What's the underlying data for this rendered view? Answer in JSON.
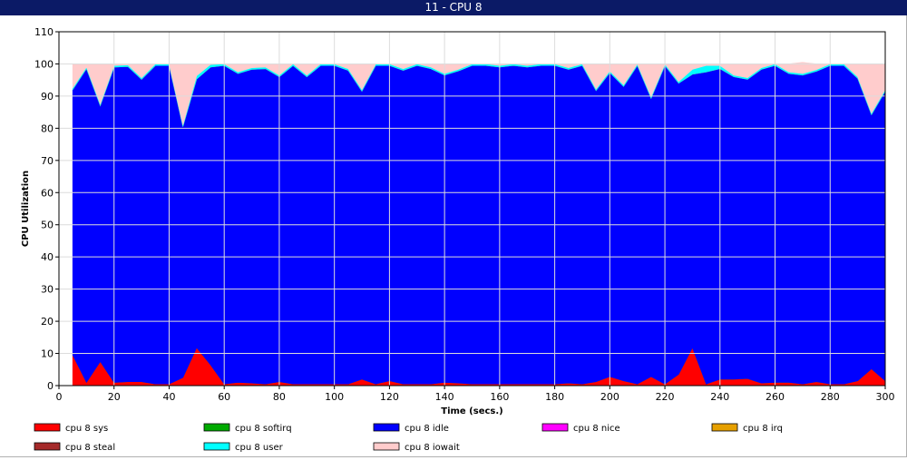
{
  "window": {
    "title": "11 - CPU 8"
  },
  "chart_data": {
    "type": "area",
    "title": "",
    "xlabel": "Time (secs.)",
    "ylabel": "CPU Utilization",
    "xlim": [
      0,
      300
    ],
    "ylim": [
      0,
      110
    ],
    "xticks": [
      0,
      20,
      40,
      60,
      80,
      100,
      120,
      140,
      160,
      180,
      200,
      220,
      240,
      260,
      280,
      300
    ],
    "yticks": [
      0,
      10,
      20,
      30,
      40,
      50,
      60,
      70,
      80,
      90,
      100,
      110
    ],
    "grid": true,
    "legend_position": "bottom",
    "x": [
      5,
      10,
      15,
      20,
      25,
      30,
      35,
      40,
      45,
      50,
      55,
      60,
      65,
      70,
      75,
      80,
      85,
      90,
      95,
      100,
      105,
      110,
      115,
      120,
      125,
      130,
      135,
      140,
      145,
      150,
      155,
      160,
      165,
      170,
      175,
      180,
      185,
      190,
      195,
      200,
      205,
      210,
      215,
      220,
      225,
      230,
      235,
      240,
      245,
      250,
      255,
      260,
      265,
      270,
      275,
      280,
      285,
      290,
      295,
      300
    ],
    "series": [
      {
        "name": "cpu 8 sys",
        "color": "#ff0000",
        "values": [
          9.5,
          1.0,
          7.5,
          1.0,
          1.2,
          1.2,
          0.5,
          0.5,
          2.5,
          11.8,
          6.5,
          0.5,
          1.0,
          0.8,
          0.5,
          1.2,
          0.5,
          0.5,
          0.5,
          0.5,
          0.5,
          2.0,
          0.5,
          1.5,
          0.5,
          0.5,
          0.5,
          1.0,
          0.8,
          0.5,
          0.5,
          0.5,
          0.5,
          0.5,
          0.5,
          0.5,
          0.8,
          0.5,
          1.2,
          2.8,
          1.5,
          0.5,
          2.8,
          0.5,
          3.5,
          11.8,
          0.5,
          2.0,
          2.0,
          2.2,
          0.8,
          1.0,
          1.0,
          0.5,
          1.2,
          0.5,
          0.5,
          1.5,
          5.2,
          1.5
        ]
      },
      {
        "name": "cpu 8 softirq",
        "color": "#00aa00",
        "values": [
          0,
          0,
          0,
          0,
          0,
          0,
          0,
          0,
          0,
          0,
          0,
          0,
          0,
          0,
          0,
          0,
          0,
          0,
          0,
          0,
          0,
          0,
          0,
          0,
          0,
          0,
          0,
          0,
          0,
          0,
          0,
          0,
          0,
          0,
          0,
          0,
          0,
          0,
          0,
          0,
          0,
          0,
          0,
          0,
          0,
          0,
          0,
          0,
          0,
          0,
          0,
          0,
          0,
          0,
          0,
          0,
          0,
          0,
          0,
          0
        ]
      },
      {
        "name": "cpu 8 idle",
        "color": "#0000ff",
        "values": [
          82.5,
          97.5,
          79.5,
          98.0,
          98.0,
          94.0,
          99.0,
          99.0,
          78.0,
          83.5,
          92.5,
          99.0,
          96.0,
          97.5,
          98.0,
          94.8,
          99.0,
          95.5,
          99.0,
          99.0,
          97.5,
          89.5,
          99.0,
          98.0,
          97.5,
          99.0,
          98.0,
          95.5,
          97.0,
          99.0,
          99.0,
          98.5,
          99.0,
          98.5,
          99.0,
          99.0,
          97.5,
          99.0,
          90.5,
          94.5,
          91.5,
          99.0,
          86.5,
          99.0,
          90.5,
          85.0,
          97.0,
          96.5,
          94.0,
          93.0,
          97.5,
          98.5,
          96.0,
          96.0,
          96.5,
          99.0,
          99.0,
          94.0,
          79.0,
          90.0
        ]
      },
      {
        "name": "cpu 8 nice",
        "color": "#ff00ff",
        "values": [
          0,
          0,
          0,
          0,
          0,
          0,
          0,
          0,
          0,
          0,
          0,
          0,
          0,
          0,
          0,
          0,
          0,
          0,
          0,
          0,
          0,
          0,
          0,
          0,
          0,
          0,
          0,
          0,
          0,
          0,
          0,
          0,
          0,
          0,
          0,
          0,
          0,
          0,
          0,
          0,
          0,
          0,
          0,
          0,
          0,
          0,
          0,
          0,
          0,
          0,
          0,
          0,
          0,
          0,
          0,
          0,
          0,
          0,
          0,
          0
        ]
      },
      {
        "name": "cpu 8 irq",
        "color": "#e6a000",
        "values": [
          0,
          0,
          0,
          0,
          0,
          0,
          0,
          0,
          0,
          0,
          0,
          0,
          0,
          0,
          0,
          0,
          0,
          0,
          0,
          0,
          0,
          0,
          0,
          0,
          0,
          0,
          0,
          0,
          0,
          0,
          0,
          0,
          0,
          0,
          0,
          0,
          0,
          0,
          0,
          0,
          0,
          0,
          0,
          0,
          0,
          0,
          0,
          0,
          0,
          0,
          0,
          0,
          0,
          0,
          0,
          0,
          0,
          0,
          0,
          0
        ]
      },
      {
        "name": "cpu 8 steal",
        "color": "#a52a2a",
        "values": [
          0,
          0,
          0,
          0,
          0,
          0,
          0,
          0,
          0,
          0,
          0,
          0,
          0,
          0,
          0,
          0,
          0,
          0,
          0,
          0,
          0,
          0,
          0,
          0,
          0,
          0,
          0,
          0,
          0,
          0,
          0,
          0,
          0,
          0,
          0,
          0,
          0,
          0,
          0,
          0,
          0,
          0,
          0,
          0,
          0,
          0,
          0,
          0,
          0,
          0,
          0,
          0,
          0,
          0,
          0,
          0,
          0,
          0,
          0,
          0
        ]
      },
      {
        "name": "cpu 8 user",
        "color": "#00ffff",
        "values": [
          0.5,
          0.5,
          0.5,
          0.5,
          0.5,
          0.5,
          0.5,
          0.5,
          0.5,
          1.0,
          0.8,
          0.5,
          0.5,
          0.5,
          0.5,
          0.5,
          0.5,
          0.5,
          0.5,
          0.5,
          0.5,
          0.5,
          0.5,
          0.5,
          0.5,
          0.5,
          0.5,
          0.5,
          0.5,
          0.5,
          0.5,
          0.5,
          0.5,
          0.5,
          0.5,
          0.5,
          0.5,
          0.5,
          0.5,
          0.5,
          0.5,
          0.5,
          0.5,
          0.5,
          0.5,
          1.5,
          2.0,
          1.0,
          0.5,
          0.5,
          0.5,
          0.5,
          0.5,
          0.5,
          0.5,
          0.5,
          0.5,
          0.5,
          0.5,
          0.5
        ]
      },
      {
        "name": "cpu 8 iowait",
        "color": "#ffcccc",
        "values": [
          7.5,
          1.0,
          12.5,
          0.5,
          0.3,
          4.3,
          0,
          0,
          19.0,
          3.7,
          0.2,
          0,
          2.5,
          1.2,
          1.0,
          3.5,
          0,
          3.5,
          0,
          0,
          1.5,
          8.0,
          0,
          0,
          1.5,
          0,
          1.0,
          3.0,
          1.7,
          0,
          0,
          0.5,
          0,
          0.5,
          0,
          0,
          1.2,
          0,
          7.8,
          2.2,
          6.5,
          0,
          10.2,
          0,
          5.5,
          1.7,
          0.5,
          0.5,
          3.5,
          4.3,
          1.2,
          0,
          2.5,
          3.5,
          1.8,
          0,
          0,
          4.0,
          15.3,
          8.0
        ]
      }
    ]
  }
}
